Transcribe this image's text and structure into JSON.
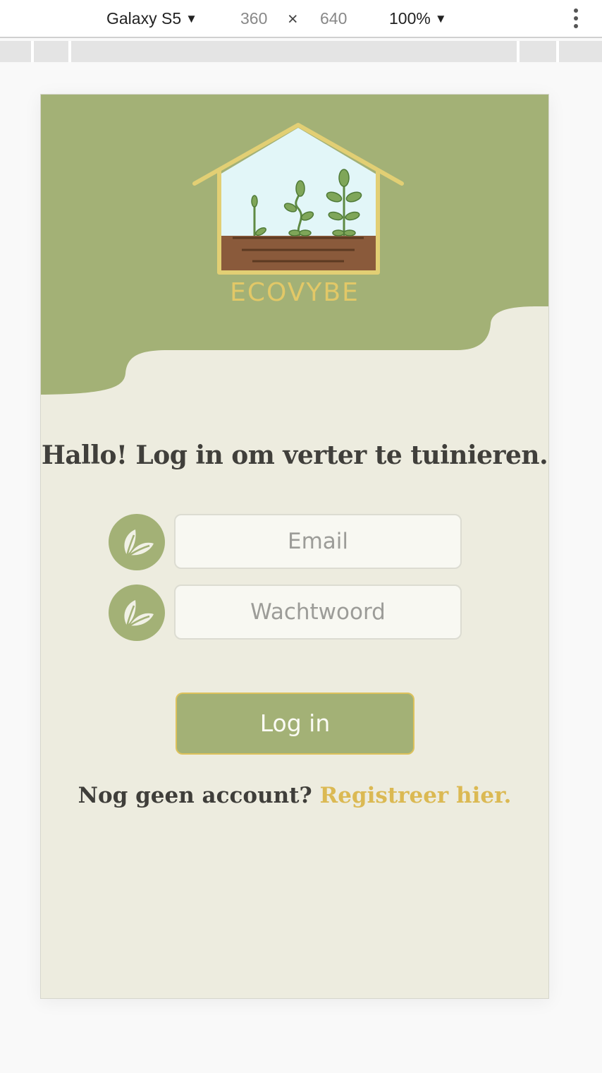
{
  "devtools": {
    "device": "Galaxy S5",
    "width": "360",
    "times": "×",
    "height": "640",
    "zoom": "100%",
    "caret": "▼"
  },
  "app": {
    "brand": "ECOVYBE",
    "headline": "Hallo! Log in om verter te tuinieren.",
    "email_placeholder": "Email",
    "password_placeholder": "Wachtwoord",
    "login_label": "Log in",
    "register_prompt": "Nog geen account?",
    "register_link": "Registreer hier."
  },
  "colors": {
    "primary_green": "#a3b176",
    "background": "#edecdf",
    "accent_gold": "#dbb953",
    "text_dark": "#403f3b"
  },
  "icons": [
    "leaf-icon",
    "greenhouse-logo",
    "kebab-menu-icon",
    "caret-down-icon"
  ]
}
